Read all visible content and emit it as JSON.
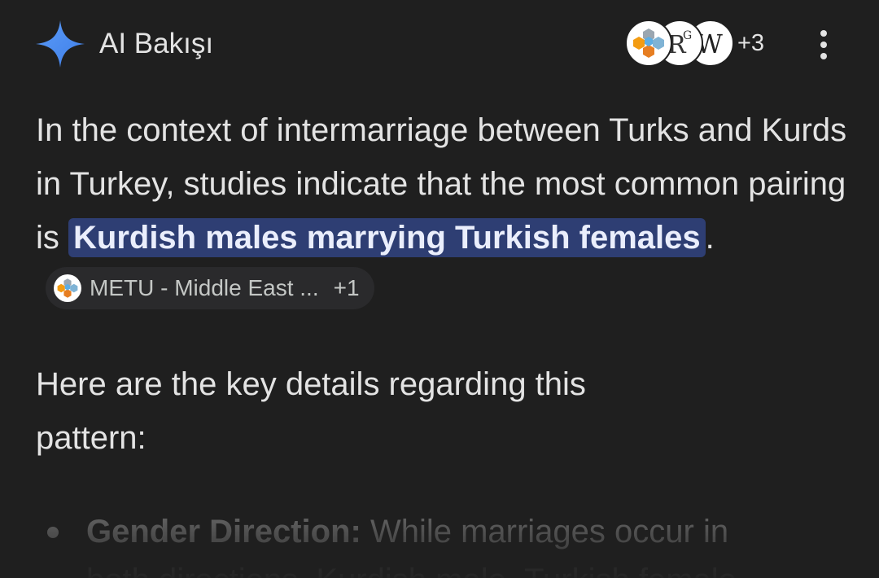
{
  "header": {
    "title": "AI Bakışı",
    "logo_icon": "gemini-sparkle-icon",
    "sources": [
      {
        "icon": "metu-hexagon-logo-icon"
      },
      {
        "icon": "researchgate-logo-icon",
        "glyph": "RG"
      },
      {
        "icon": "wikipedia-logo-icon",
        "glyph": "W"
      }
    ],
    "more_sources": "+3",
    "menu_icon": "more-vertical-icon"
  },
  "paragraph1": {
    "text_before": "In the context of intermarriage between Turks and Kurds in Turkey, studies indicate that the most common pairing is ",
    "highlight": "Kurdish males marrying Turkish females",
    "text_after": ".",
    "citation": {
      "label": "METU - Middle East ...",
      "extra": "+1",
      "icon": "metu-hexagon-logo-icon"
    }
  },
  "paragraph2": {
    "text": "Here are the key details regarding this pattern:"
  },
  "bullets": [
    {
      "title": "Gender Direction:",
      "text": " While marriages occur in",
      "continuation": "both directions, Kurdish male–Turkish female"
    }
  ],
  "colors": {
    "background": "#1f1f1f",
    "highlight_bg": "#2e3e73",
    "text": "#e3e3e3",
    "muted": "#8a8a8a",
    "gemini_blue": "#4f8cf5"
  }
}
